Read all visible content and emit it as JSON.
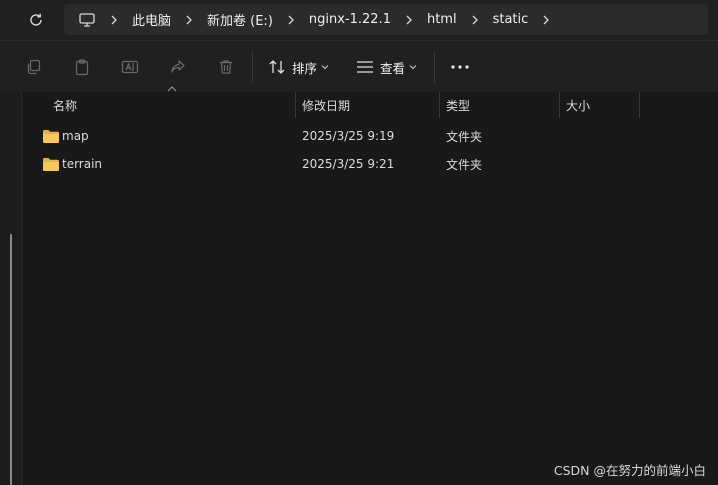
{
  "breadcrumbs": [
    "此电脑",
    "新加卷 (E:)",
    "nginx-1.22.1",
    "html",
    "static"
  ],
  "toolbar": {
    "sort_label": "排序",
    "view_label": "查看"
  },
  "columns": {
    "name": "名称",
    "date": "修改日期",
    "type": "类型",
    "size": "大小"
  },
  "files": [
    {
      "name": "map",
      "date": "2025/3/25 9:19",
      "type": "文件夹",
      "size": ""
    },
    {
      "name": "terrain",
      "date": "2025/3/25 9:21",
      "type": "文件夹",
      "size": ""
    }
  ],
  "watermark": "CSDN @在努力的前端小白",
  "colors": {
    "background": "#191919",
    "folder": "#f2c14e",
    "text": "#dcdcdc"
  }
}
